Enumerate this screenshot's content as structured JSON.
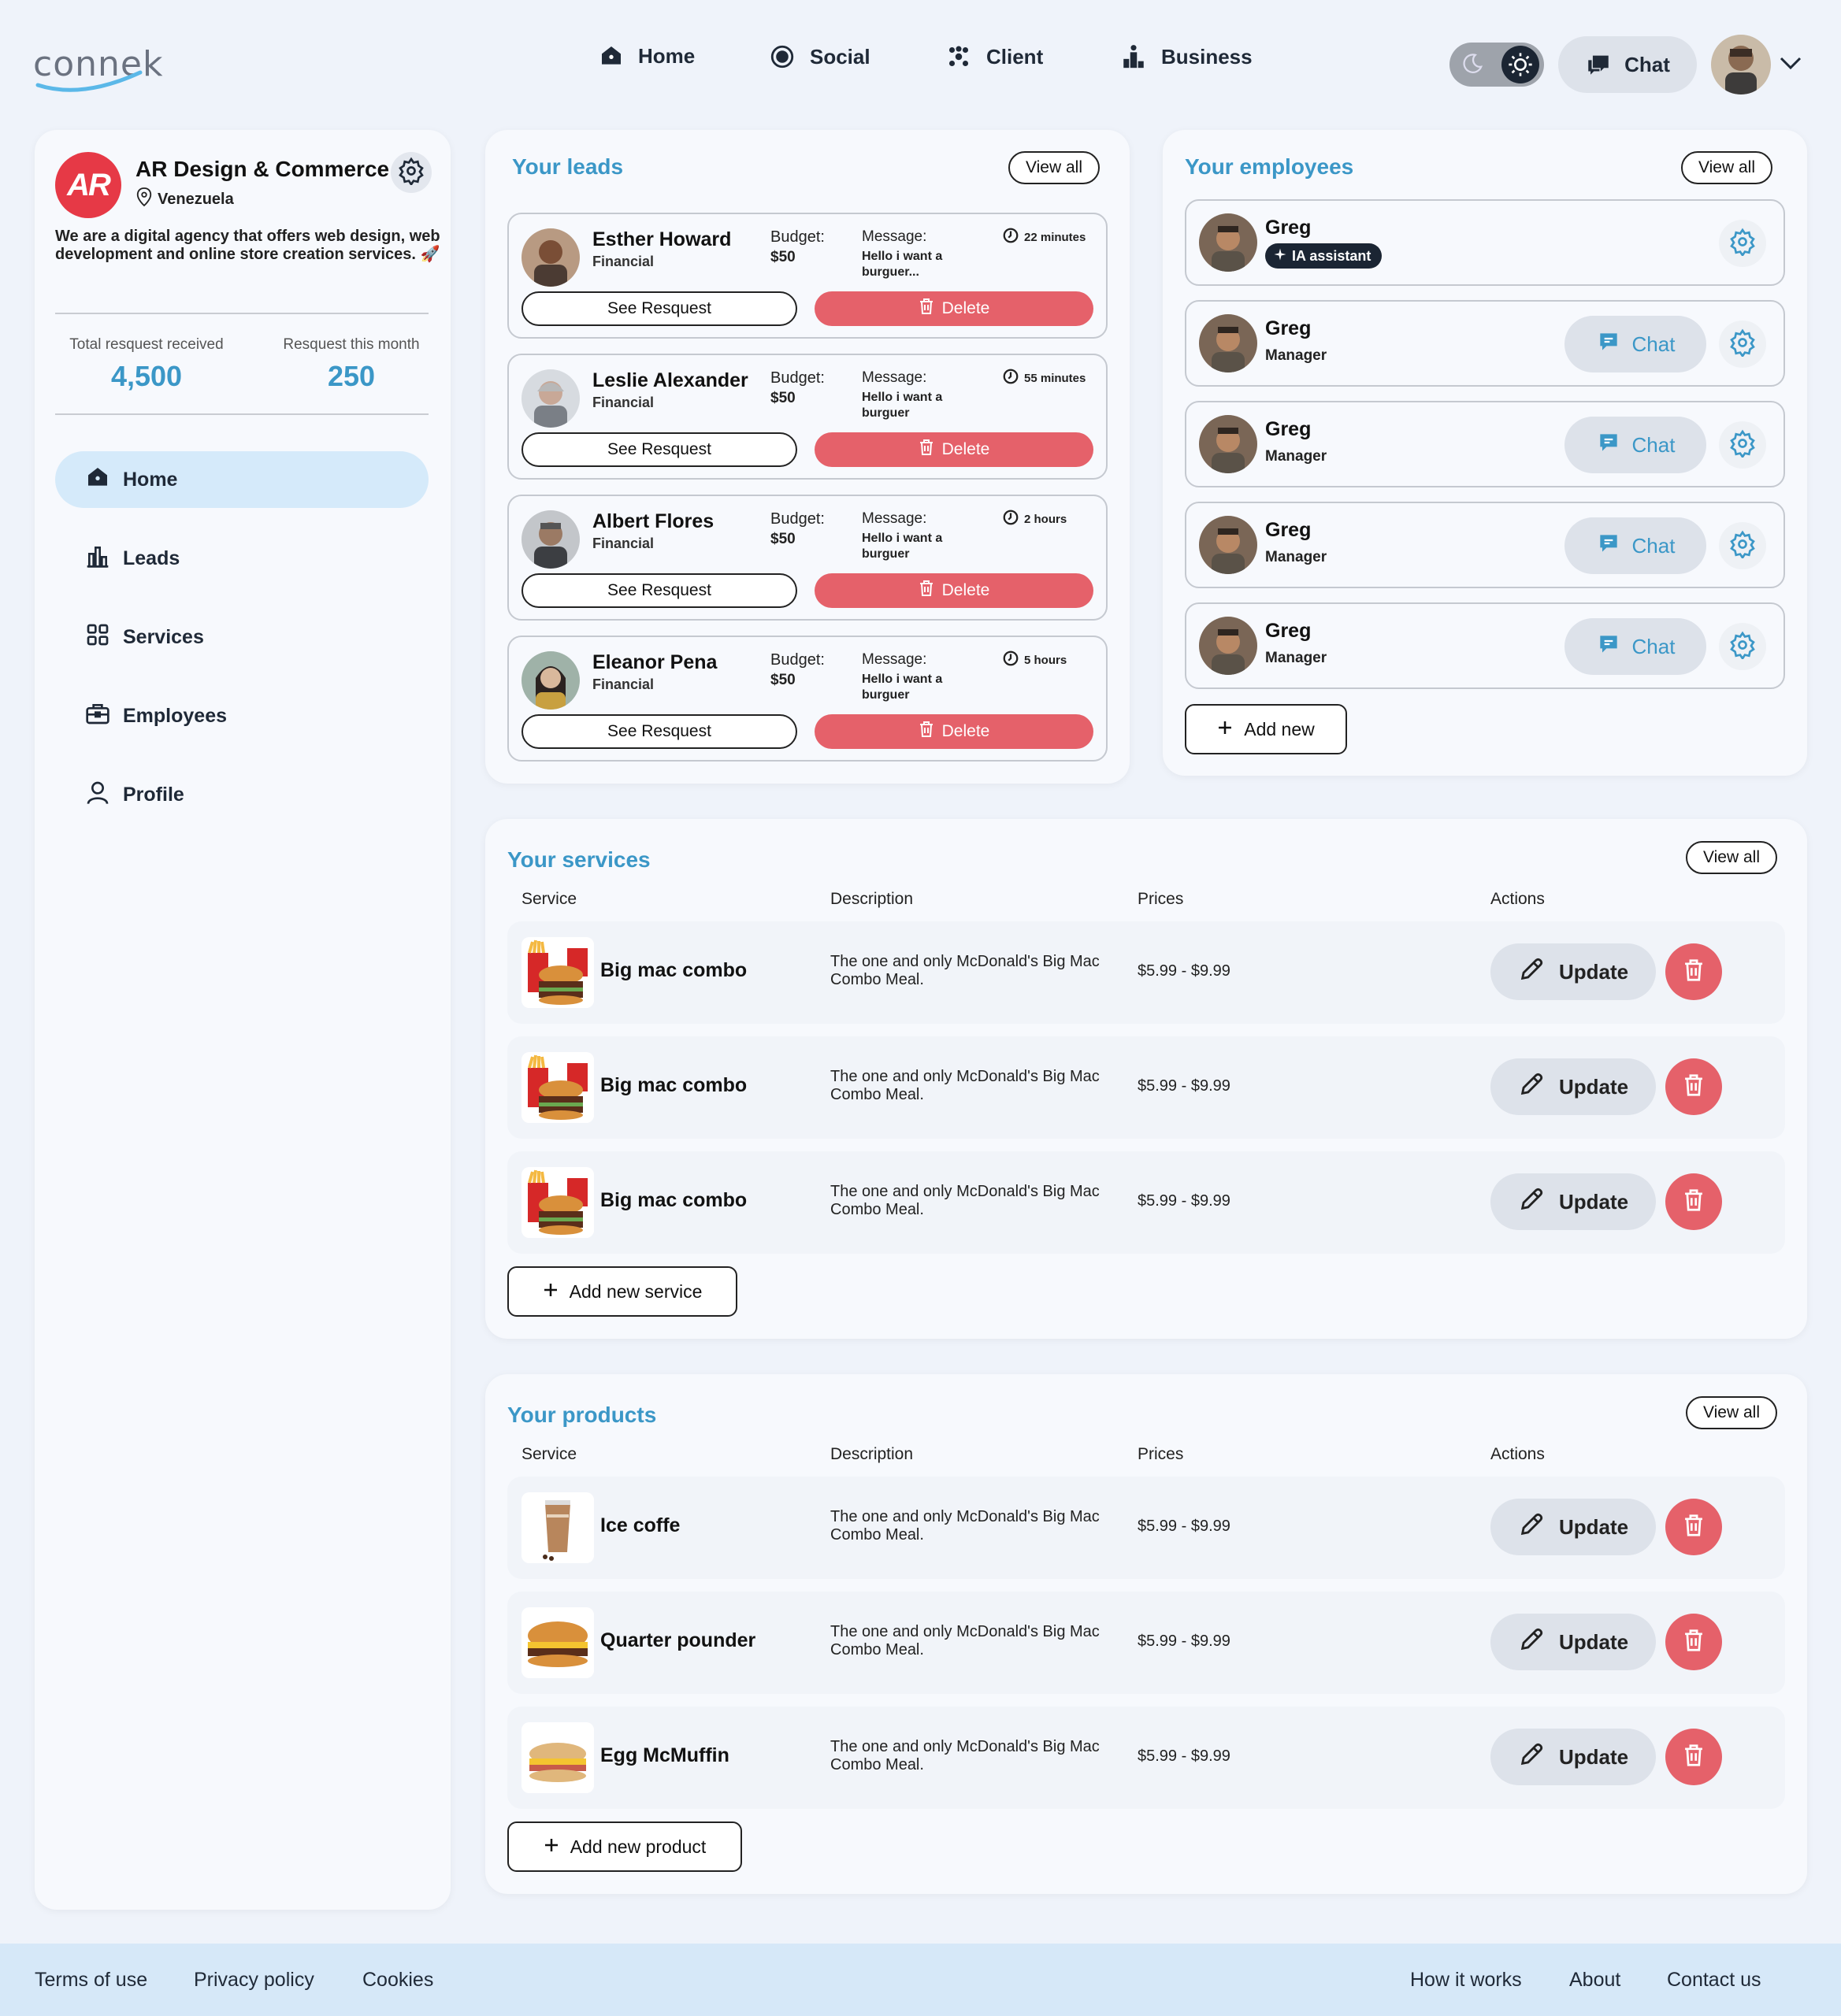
{
  "brand": {
    "logo_text": "connek"
  },
  "nav": {
    "home": "Home",
    "social": "Social",
    "client": "Client",
    "business": "Business",
    "chat": "Chat"
  },
  "sidebar": {
    "logo_initials": "AR",
    "company": "AR Design & Commerce",
    "location": "Venezuela",
    "bio": "We are a digital agency that offers web design, web development and online store creation services. 🚀",
    "stats": [
      {
        "label": "Total resquest received",
        "value": "4,500"
      },
      {
        "label": "Resquest this month",
        "value": "250"
      }
    ],
    "menu": [
      "Home",
      "Leads",
      "Services",
      "Employees",
      "Profile"
    ]
  },
  "leads": {
    "title": "Your leads",
    "view_all": "View all",
    "budget_label": "Budget:",
    "message_label": "Message:",
    "see_label": "See Resquest",
    "delete_label": "Delete",
    "items": [
      {
        "name": "Esther Howard",
        "category": "Financial",
        "budget": "$50",
        "message": "Hello i want a burguer...",
        "time": "22 minutes"
      },
      {
        "name": "Leslie Alexander",
        "category": "Financial",
        "budget": "$50",
        "message": "Hello i want a burguer",
        "time": "55 minutes"
      },
      {
        "name": "Albert Flores",
        "category": "Financial",
        "budget": "$50",
        "message": "Hello i want a burguer",
        "time": "2 hours"
      },
      {
        "name": "Eleanor Pena",
        "category": "Financial",
        "budget": "$50",
        "message": "Hello i want a burguer",
        "time": "5 hours"
      }
    ]
  },
  "employees": {
    "title": "Your employees",
    "view_all": "View all",
    "chat_label": "Chat",
    "add_label": "Add new",
    "items": [
      {
        "name": "Greg",
        "badge": "IA assistant"
      },
      {
        "name": "Greg",
        "role": "Manager"
      },
      {
        "name": "Greg",
        "role": "Manager"
      },
      {
        "name": "Greg",
        "role": "Manager"
      },
      {
        "name": "Greg",
        "role": "Manager"
      }
    ]
  },
  "services": {
    "title": "Your services",
    "view_all": "View all",
    "headers": [
      "Service",
      "Description",
      "Prices",
      "Actions"
    ],
    "update_label": "Update",
    "add_label": "Add new service",
    "items": [
      {
        "name": "Big mac combo",
        "description": "The one and only McDonald's Big Mac Combo Meal.",
        "price": "$5.99 - $9.99"
      },
      {
        "name": "Big mac combo",
        "description": "The one and only McDonald's Big Mac Combo Meal.",
        "price": "$5.99 - $9.99"
      },
      {
        "name": "Big mac combo",
        "description": "The one and only McDonald's Big Mac Combo Meal.",
        "price": "$5.99 - $9.99"
      }
    ]
  },
  "products": {
    "title": "Your products",
    "view_all": "View all",
    "headers": [
      "Service",
      "Description",
      "Prices",
      "Actions"
    ],
    "update_label": "Update",
    "add_label": "Add new product",
    "items": [
      {
        "name": "Ice coffe",
        "description": "The one and only McDonald's Big Mac Combo Meal.",
        "price": "$5.99 - $9.99"
      },
      {
        "name": "Quarter pounder",
        "description": "The one and only McDonald's Big Mac Combo Meal.",
        "price": "$5.99 - $9.99"
      },
      {
        "name": "Egg McMuffin",
        "description": "The one and only McDonald's Big Mac Combo Meal.",
        "price": "$5.99 - $9.99"
      }
    ]
  },
  "footer": {
    "terms": "Terms of use",
    "privacy": "Privacy policy",
    "cookies": "Cookies",
    "how": "How it works",
    "about": "About",
    "contact": "Contact us"
  },
  "colors": {
    "accent": "#3b97c7",
    "danger": "#e5616a",
    "active_bg": "#d5eafa",
    "page_bg": "#eff3fa",
    "footer_bg": "#d6e8f8"
  }
}
